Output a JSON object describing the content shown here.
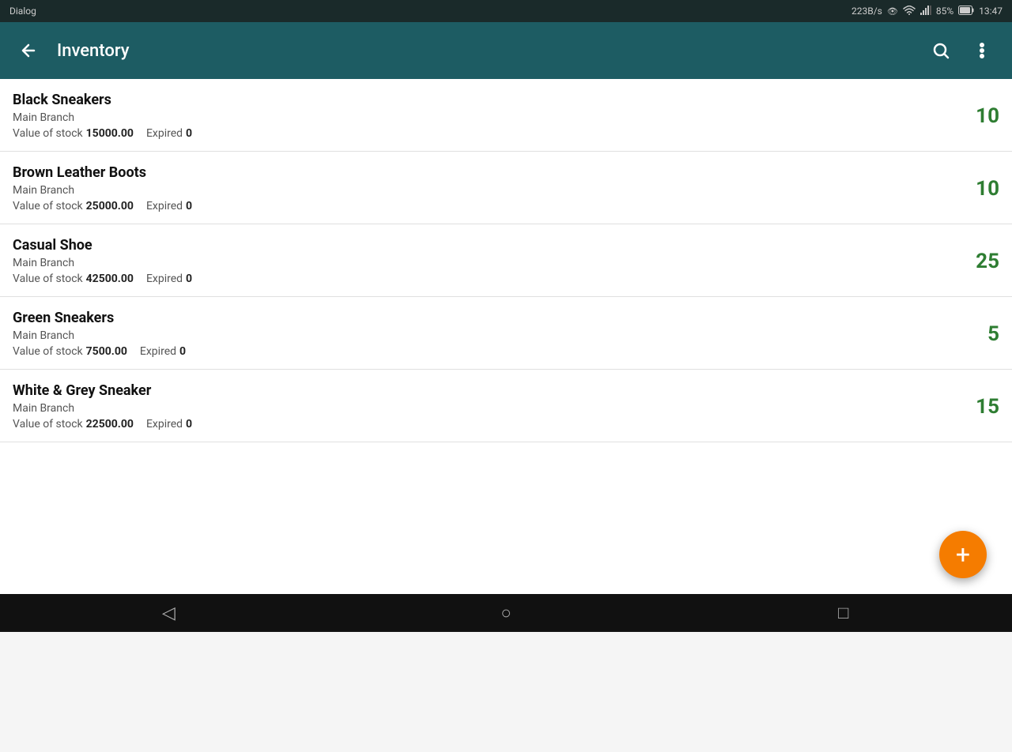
{
  "statusBar": {
    "appName": "Dialog",
    "networkSpeed": "223B/s",
    "battery": "85%",
    "time": "13:47"
  },
  "appBar": {
    "title": "Inventory",
    "backLabel": "←",
    "searchLabel": "search",
    "moreLabel": "⋮"
  },
  "items": [
    {
      "name": "Black Sneakers",
      "branch": "Main Branch",
      "valueLabel": "Value of stock",
      "value": "15000.00",
      "expiredLabel": "Expired",
      "expired": "0",
      "quantity": "10"
    },
    {
      "name": "Brown Leather Boots",
      "branch": "Main Branch",
      "valueLabel": "Value of stock",
      "value": "25000.00",
      "expiredLabel": "Expired",
      "expired": "0",
      "quantity": "10"
    },
    {
      "name": "Casual Shoe",
      "branch": "Main Branch",
      "valueLabel": "Value of stock",
      "value": "42500.00",
      "expiredLabel": "Expired",
      "expired": "0",
      "quantity": "25"
    },
    {
      "name": "Green Sneakers",
      "branch": "Main Branch",
      "valueLabel": "Value of stock",
      "value": "7500.00",
      "expiredLabel": "Expired",
      "expired": "0",
      "quantity": "5"
    },
    {
      "name": "White & Grey Sneaker",
      "branch": "Main Branch",
      "valueLabel": "Value of stock",
      "value": "22500.00",
      "expiredLabel": "Expired",
      "expired": "0",
      "quantity": "15"
    }
  ],
  "fab": {
    "label": "+"
  },
  "bottomNav": {
    "back": "◁",
    "home": "○",
    "recent": "□"
  }
}
